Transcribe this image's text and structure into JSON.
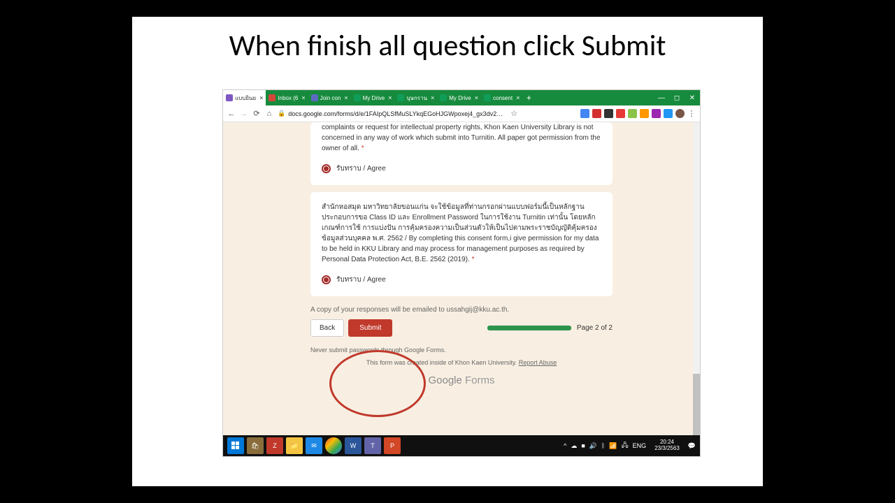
{
  "slide": {
    "title": "When finish all question click Submit"
  },
  "window": {
    "tabs": [
      {
        "label": "แบบยินย"
      },
      {
        "label": "Inbox (6"
      },
      {
        "label": "Join con"
      },
      {
        "label": "My Drive"
      },
      {
        "label": "บุษกราน"
      },
      {
        "label": "My Drive"
      },
      {
        "label": "consent"
      }
    ],
    "url": "docs.google.com/forms/d/e/1FAIpQLSfMuSLYkqEGoHJGWpoxej4_gx3dv2…"
  },
  "form": {
    "card1": {
      "text": "complaints or request for intellectual property rights, Khon Kaen University Library is not concerned in any way of work which submit into Turnitin. All paper got permission from the owner of all.",
      "required": "*",
      "option": "รับทราบ / Agree"
    },
    "card2": {
      "text": "สำนักหอสมุด มหาวิทยาลัยขอนแก่น จะใช้ข้อมูลที่ท่านกรอกผ่านแบบฟอร์มนี้เป็นหลักฐานประกอบการขอ Class ID และ Enrollment Password ในการใช้งาน Turnitin เท่านั้น โดยหลักเกณฑ์การใช้ การแบ่งปัน การคุ้มครองความเป็นส่วนตัวให้เป็นไปตามพระราชบัญญัติคุ้มครองข้อมูลส่วนบุคคล พ.ศ. 2562 / By completing this consent form,i give permission for my data to be held in KKU Library and may process for management purposes as required by Personal Data Protection Act, B.E. 2562 (2019).",
      "required": "*",
      "option": "รับทราบ / Agree"
    },
    "email_note": "A copy of your responses will be emailed to ussahgij@kku.ac.th.",
    "back_label": "Back",
    "submit_label": "Submit",
    "page_label": "Page 2 of 2",
    "pw_warning": "Never submit passwords through Google Forms.",
    "created_text": "This form was created inside of Khon Kaen University.",
    "report_abuse": "Report Abuse",
    "logo_bold": "Google",
    "logo_light": " Forms"
  },
  "taskbar": {
    "lang": "ENG",
    "time": "20:24",
    "date": "23/3/2563"
  }
}
